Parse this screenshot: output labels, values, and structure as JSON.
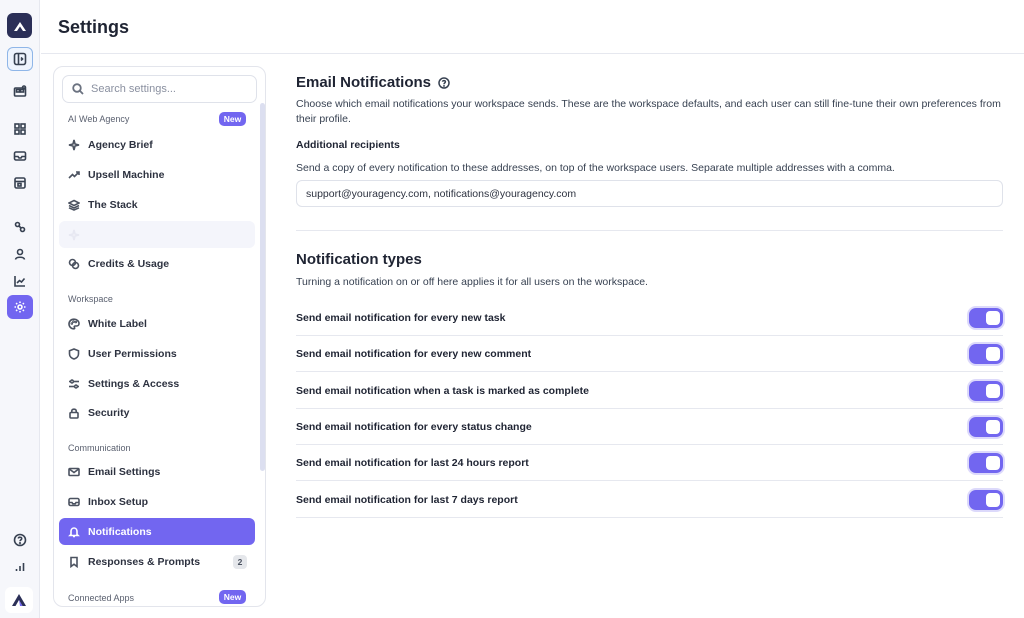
{
  "page": {
    "title": "Settings"
  },
  "rail": {
    "icons": [
      "app-logo",
      "sidebar-toggle-icon",
      "boxes-icon",
      "grid-icon",
      "inbox-icon",
      "calendar-icon",
      "workflow-icon",
      "user-icon",
      "chart-icon",
      "settings-icon",
      "help-icon",
      "bar-chart-icon",
      "brand-logo"
    ],
    "active": "settings-icon"
  },
  "sidebar": {
    "search_placeholder": "Search settings...",
    "sections": {
      "ai": {
        "label": "AI Web Agency",
        "badge": "New"
      },
      "workspace": {
        "label": "Workspace"
      },
      "communication": {
        "label": "Communication"
      },
      "connected": {
        "label": "Connected Apps",
        "badge": "New"
      }
    },
    "items": [
      {
        "label": "Agency Brief",
        "icon": "sparkle-icon"
      },
      {
        "label": "Upsell Machine",
        "icon": "trend-icon"
      },
      {
        "label": "The Stack",
        "icon": "layers-icon"
      },
      {
        "label": "Credits & Usage",
        "icon": "coins-icon"
      },
      {
        "label": "White Label",
        "icon": "palette-icon"
      },
      {
        "label": "User Permissions",
        "icon": "shield-icon"
      },
      {
        "label": "Settings & Access",
        "icon": "sliders-icon"
      },
      {
        "label": "Security",
        "icon": "lock-icon"
      },
      {
        "label": "Email Settings",
        "icon": "mail-icon"
      },
      {
        "label": "Inbox Setup",
        "icon": "inbox-icon"
      },
      {
        "label": "Notifications",
        "icon": "bell-icon",
        "active": true
      },
      {
        "label": "Responses & Prompts",
        "icon": "bookmark-icon",
        "count": "2"
      }
    ]
  },
  "email": {
    "title": "Email Notifications",
    "description": "Choose which email notifications your workspace sends. These are the workspace defaults, and each user can still fine-tune their own preferences from their profile.",
    "recipients_label": "Additional recipients",
    "recipients_help": "Send a copy of every notification to these addresses, on top of the workspace users. Separate multiple addresses with a comma.",
    "recipients_value": "support@youragency.com, notifications@youragency.com"
  },
  "types": {
    "title": "Notification types",
    "description": "Turning a notification on or off here applies it for all users on the workspace.",
    "rows": [
      {
        "label": "Send email notification for every new task",
        "on": true
      },
      {
        "label": "Send email notification for every new comment",
        "on": true
      },
      {
        "label": "Send email notification when a task is marked as complete",
        "on": true
      },
      {
        "label": "Send email notification for every status change",
        "on": true
      },
      {
        "label": "Send email notification for last 24 hours report",
        "on": true
      },
      {
        "label": "Send email notification for last 7 days report",
        "on": true
      }
    ]
  },
  "colors": {
    "accent": "#7266f0",
    "rail_bg": "#f6f7fb",
    "logo_bg": "#2b2f57"
  }
}
